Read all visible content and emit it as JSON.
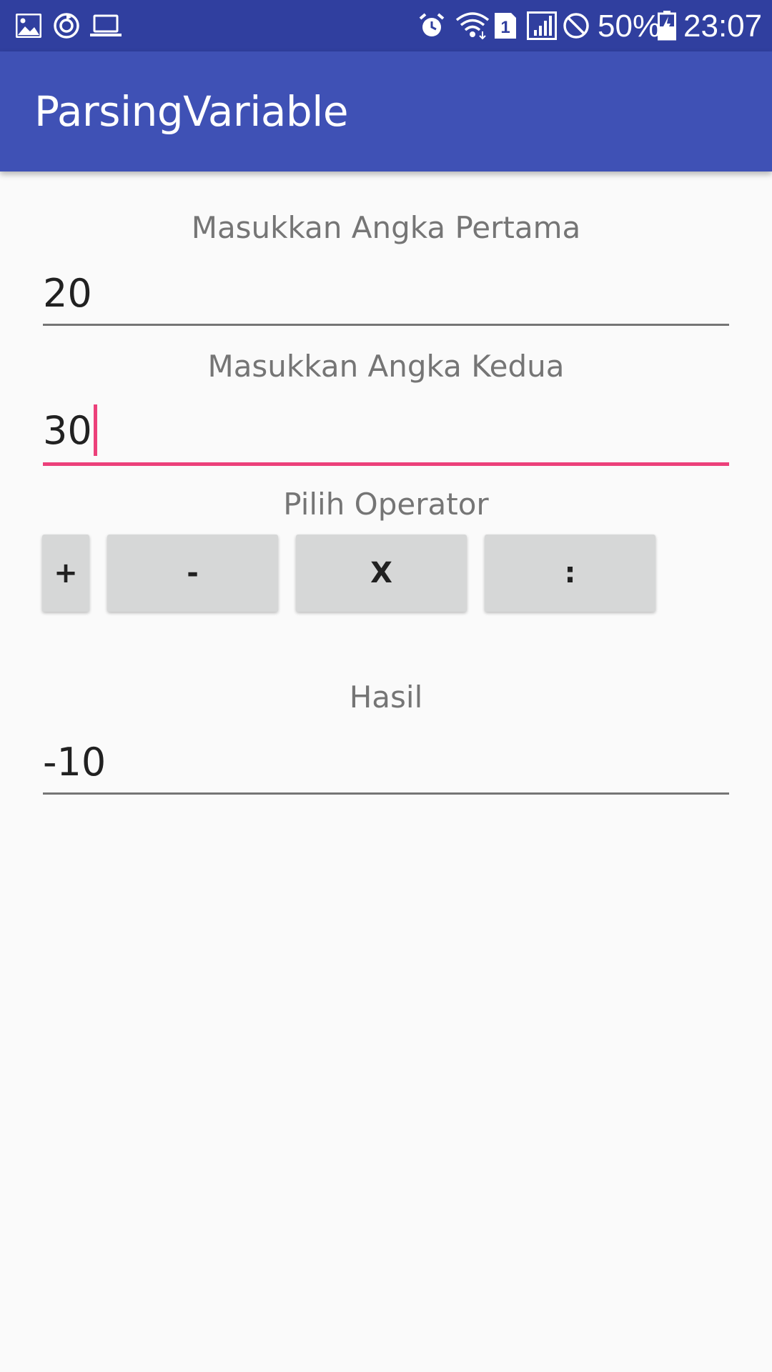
{
  "status_bar": {
    "icons_left": [
      "image-icon",
      "sync-icon",
      "laptop-icon"
    ],
    "icons_right": [
      "alarm-icon",
      "wifi-icon",
      "sim-icon",
      "signal-icon",
      "do-not-disturb-icon"
    ],
    "sim_number": "1",
    "battery": "50%",
    "time": "23:07",
    "battery_icon": "battery-charging-icon"
  },
  "app_bar": {
    "title": "ParsingVariable",
    "color": "#3f51b5",
    "status_color": "#303f9f"
  },
  "form": {
    "first_label": "Masukkan Angka Pertama",
    "first_value": "20",
    "second_label": "Masukkan Angka Kedua",
    "second_value": "30",
    "operator_label": "Pilih Operator",
    "operators": {
      "add": "+",
      "subtract": "-",
      "multiply": "X",
      "divide": ":"
    },
    "result_label": "Hasil",
    "result_value": "-10"
  },
  "colors": {
    "accent": "#e91e63",
    "background": "#fafafa",
    "button": "#d6d7d7"
  }
}
